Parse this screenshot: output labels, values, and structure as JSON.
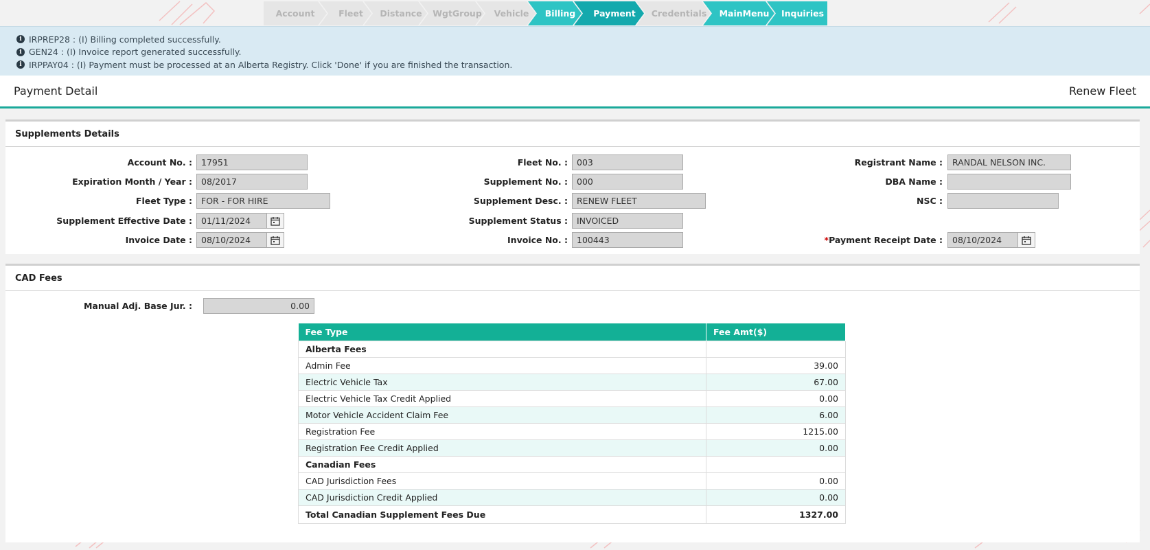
{
  "wizard": {
    "steps": [
      {
        "label": "Account",
        "state": "done"
      },
      {
        "label": "Fleet",
        "state": "done"
      },
      {
        "label": "Distance",
        "state": "done"
      },
      {
        "label": "WgtGroup",
        "state": "done"
      },
      {
        "label": "Vehicle",
        "state": "done"
      },
      {
        "label": "Billing",
        "state": "active"
      },
      {
        "label": "Payment",
        "state": "current"
      },
      {
        "label": "Credentials",
        "state": "done"
      },
      {
        "label": "MainMenu",
        "state": "active"
      },
      {
        "label": "Inquiries",
        "state": "active"
      }
    ]
  },
  "messages": [
    "IRPREP28 : (I) Billing completed successfully.",
    "GEN24 : (I) Invoice report generated successfully.",
    "IRPPAY04 : (I) Payment must be processed at an Alberta Registry. Click 'Done' if you are finished the transaction."
  ],
  "header": {
    "title": "Payment Detail",
    "mode": "Renew Fleet"
  },
  "supplements": {
    "title": "Supplements Details",
    "account_no_label": "Account No. :",
    "account_no": "17951",
    "exp_label": "Expiration Month / Year :",
    "exp": "08/2017",
    "fleet_type_label": "Fleet Type :",
    "fleet_type": "FOR - FOR HIRE",
    "eff_date_label": "Supplement Effective Date :",
    "eff_date": "01/11/2024",
    "invoice_date_label": "Invoice Date :",
    "invoice_date": "08/10/2024",
    "fleet_no_label": "Fleet No. :",
    "fleet_no": "003",
    "supp_no_label": "Supplement No. :",
    "supp_no": "000",
    "supp_desc_label": "Supplement Desc. :",
    "supp_desc": "RENEW FLEET",
    "supp_status_label": "Supplement Status :",
    "supp_status": "INVOICED",
    "invoice_no_label": "Invoice No. :",
    "invoice_no": "100443",
    "registrant_label": "Registrant Name :",
    "registrant": "RANDAL NELSON INC.",
    "dba_label": "DBA Name :",
    "dba": "",
    "nsc_label": "NSC :",
    "nsc": "",
    "pay_receipt_required": "*",
    "pay_receipt_label": "Payment Receipt Date :",
    "pay_receipt": "08/10/2024"
  },
  "cad": {
    "title": "CAD Fees",
    "manual_adj_label": "Manual Adj. Base Jur. :",
    "manual_adj": "0.00",
    "table": {
      "headers": [
        "Fee Type",
        "Fee Amt($)"
      ],
      "rows": [
        {
          "type": "Alberta Fees",
          "amt": "",
          "group": true
        },
        {
          "type": "Admin Fee",
          "amt": "39.00"
        },
        {
          "type": "Electric Vehicle Tax",
          "amt": "67.00"
        },
        {
          "type": "Electric Vehicle Tax Credit Applied",
          "amt": "0.00"
        },
        {
          "type": "Motor Vehicle Accident Claim Fee",
          "amt": "6.00"
        },
        {
          "type": "Registration Fee",
          "amt": "1215.00"
        },
        {
          "type": "Registration Fee Credit Applied",
          "amt": "0.00"
        },
        {
          "type": "Canadian Fees",
          "amt": "",
          "group": true
        },
        {
          "type": "CAD Jurisdiction Fees",
          "amt": "0.00"
        },
        {
          "type": "CAD Jurisdiction Credit Applied",
          "amt": "0.00"
        }
      ],
      "total": {
        "type": "Total Canadian Supplement Fees Due",
        "amt": "1327.00"
      }
    }
  }
}
